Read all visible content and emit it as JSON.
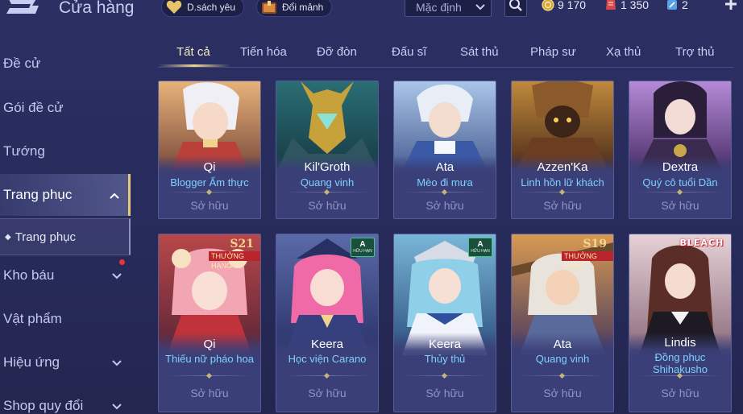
{
  "header": {
    "title": "Cửa hàng",
    "wishlist_label": "D.sách yêu",
    "exchange_label": "Đổi mảnh",
    "sort_value": "Mặc định",
    "currencies": [
      {
        "icon": "gold-coin-icon",
        "value": "9 170"
      },
      {
        "icon": "red-voucher-icon",
        "value": "1 350"
      },
      {
        "icon": "blue-ticket-icon",
        "value": "2"
      }
    ]
  },
  "sidebar": {
    "items": [
      {
        "label": "Đề cử"
      },
      {
        "label": "Gói đề cử"
      },
      {
        "label": "Tướng"
      },
      {
        "label": "Trang phục"
      },
      {
        "label": "Kho báu"
      },
      {
        "label": "Vật phẩm"
      },
      {
        "label": "Hiệu ứng"
      },
      {
        "label": "Shop quy đổi"
      }
    ],
    "sub_item": "Trang phục"
  },
  "tabs": [
    "Tất cả",
    "Tiến hóa",
    "Đỡ đòn",
    "Đấu sĩ",
    "Sát thủ",
    "Pháp sư",
    "Xạ thủ",
    "Trợ thủ"
  ],
  "cards": [
    {
      "hero": "Qi",
      "skin": "Blogger Ẩm thực",
      "status": "Sở hữu",
      "badge": ""
    },
    {
      "hero": "Kil'Groth",
      "skin": "Quang vinh",
      "status": "Sở hữu",
      "badge": ""
    },
    {
      "hero": "Ata",
      "skin": "Mèo đi mưa",
      "status": "Sở hữu",
      "badge": ""
    },
    {
      "hero": "Azzen'Ka",
      "skin": "Linh hồn lữ khách",
      "status": "Sở hữu",
      "badge": ""
    },
    {
      "hero": "Dextra",
      "skin": "Quý cô tuổi Dần",
      "status": "Sở hữu",
      "badge": ""
    },
    {
      "hero": "Qi",
      "skin": "Thiếu nữ pháo hoa",
      "status": "Sở hữu",
      "badge": "S21",
      "badge_text": "THƯỞNG HẠNG"
    },
    {
      "hero": "Keera",
      "skin": "Học viện Carano",
      "status": "Sở hữu",
      "badge": "A",
      "badge_text": "HỮU HẠN"
    },
    {
      "hero": "Keera",
      "skin": "Thủy thủ",
      "status": "Sở hữu",
      "badge": "A",
      "badge_text": "HỮU HẠN"
    },
    {
      "hero": "Ata",
      "skin": "Quang vinh",
      "status": "Sở hữu",
      "badge": "S19",
      "badge_text": "THƯỞNG HẠNG"
    },
    {
      "hero": "Lindis",
      "skin": "Đồng phục Shihakusho",
      "status": "Sở hữu",
      "badge": "BLEACH"
    }
  ],
  "colors": {
    "accent_gold": "#f1d48b",
    "skin_blue": "#7fd0ff",
    "badge_red": "#b8262c",
    "notification_red": "#e8343c"
  }
}
